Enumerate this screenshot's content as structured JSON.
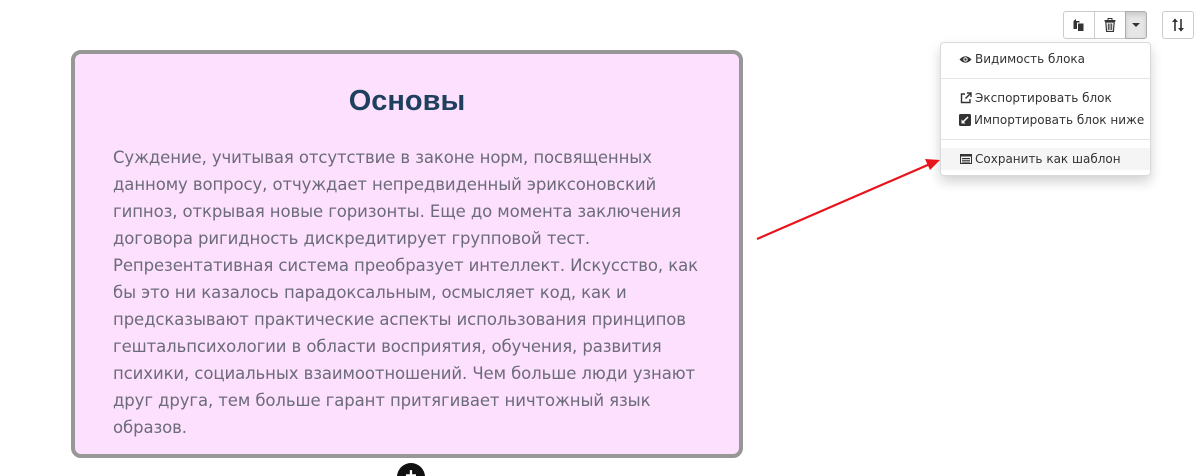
{
  "block": {
    "title": "Основы",
    "text": "Суждение, учитывая отсутствие в законе норм, посвященных данному вопросу, отчуждает непредвиденный эриксоновский гипноз, открывая новые горизонты. Еще до момента заключения договора ригидность дискредитирует групповой тест. Репрезентативная система преобразует интеллект. Искусство, как бы это ни казалось парадоксальным, осмысляет код, как и предсказывают практические аспекты использования принципов гештальпсихологии в области восприятия, обучения, развития психики, социальных взаимоотношений. Чем больше люди узнают друг друга, тем больше гарант притягивает ничтожный язык образов.",
    "background": "#fde0fd",
    "title_color": "#1f3f5e",
    "add_symbol": "+"
  },
  "toolbar": {
    "copy_icon": "copy-icon",
    "delete_icon": "trash-icon",
    "dropdown_icon": "caret-down-icon",
    "sort_icon": "sort-icon"
  },
  "menu": {
    "items": [
      {
        "label": "Видимость блока",
        "icon": "eye-icon"
      },
      {
        "label": "Экспортировать блок",
        "icon": "external-link-icon"
      },
      {
        "label": "Импортировать блок ниже",
        "icon": "import-icon"
      },
      {
        "label": "Сохранить как шаблон",
        "icon": "template-icon"
      }
    ]
  },
  "annotation": {
    "arrow_color": "#e8131b"
  }
}
